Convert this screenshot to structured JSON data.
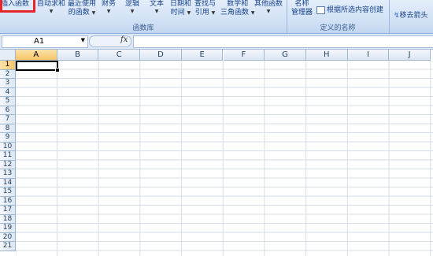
{
  "ribbon": {
    "function_library": {
      "insert_function": "插入函数",
      "autosum": "自动求和",
      "recently_used_l1": "最近使用",
      "recently_used_l2": "的函数",
      "financial": "财务",
      "logical": "逻辑",
      "text": "文本",
      "datetime_l1": "日期和",
      "datetime_l2": "时间",
      "lookup_l1": "查找与",
      "lookup_l2": "引用",
      "math_l1": "数学和",
      "math_l2": "三角函数",
      "more": "其他函数",
      "group_label": "函数库"
    },
    "defined_names": {
      "name_manager_l1": "名称",
      "name_manager_l2": "管理器",
      "create_from_selection": "根据所选内容创建",
      "group_label": "定义的名称"
    },
    "formula_auditing": {
      "remove_arrows": "移去箭头"
    }
  },
  "formula_bar": {
    "name_box": "A1",
    "fx_label": "fx",
    "formula": ""
  },
  "sheet": {
    "columns": [
      "A",
      "B",
      "C",
      "D",
      "E",
      "F",
      "G",
      "H",
      "I",
      "J"
    ],
    "rows": [
      "1",
      "2",
      "3",
      "4",
      "5",
      "6",
      "7",
      "8",
      "9",
      "10",
      "11",
      "12",
      "13",
      "14",
      "15",
      "16",
      "17",
      "18",
      "19",
      "20",
      "21"
    ],
    "active_cell": "A1"
  },
  "colors": {
    "highlight_box": "#e8262a",
    "ribbon_bg": "#cfdff4",
    "header_active": "#f6c56a"
  }
}
